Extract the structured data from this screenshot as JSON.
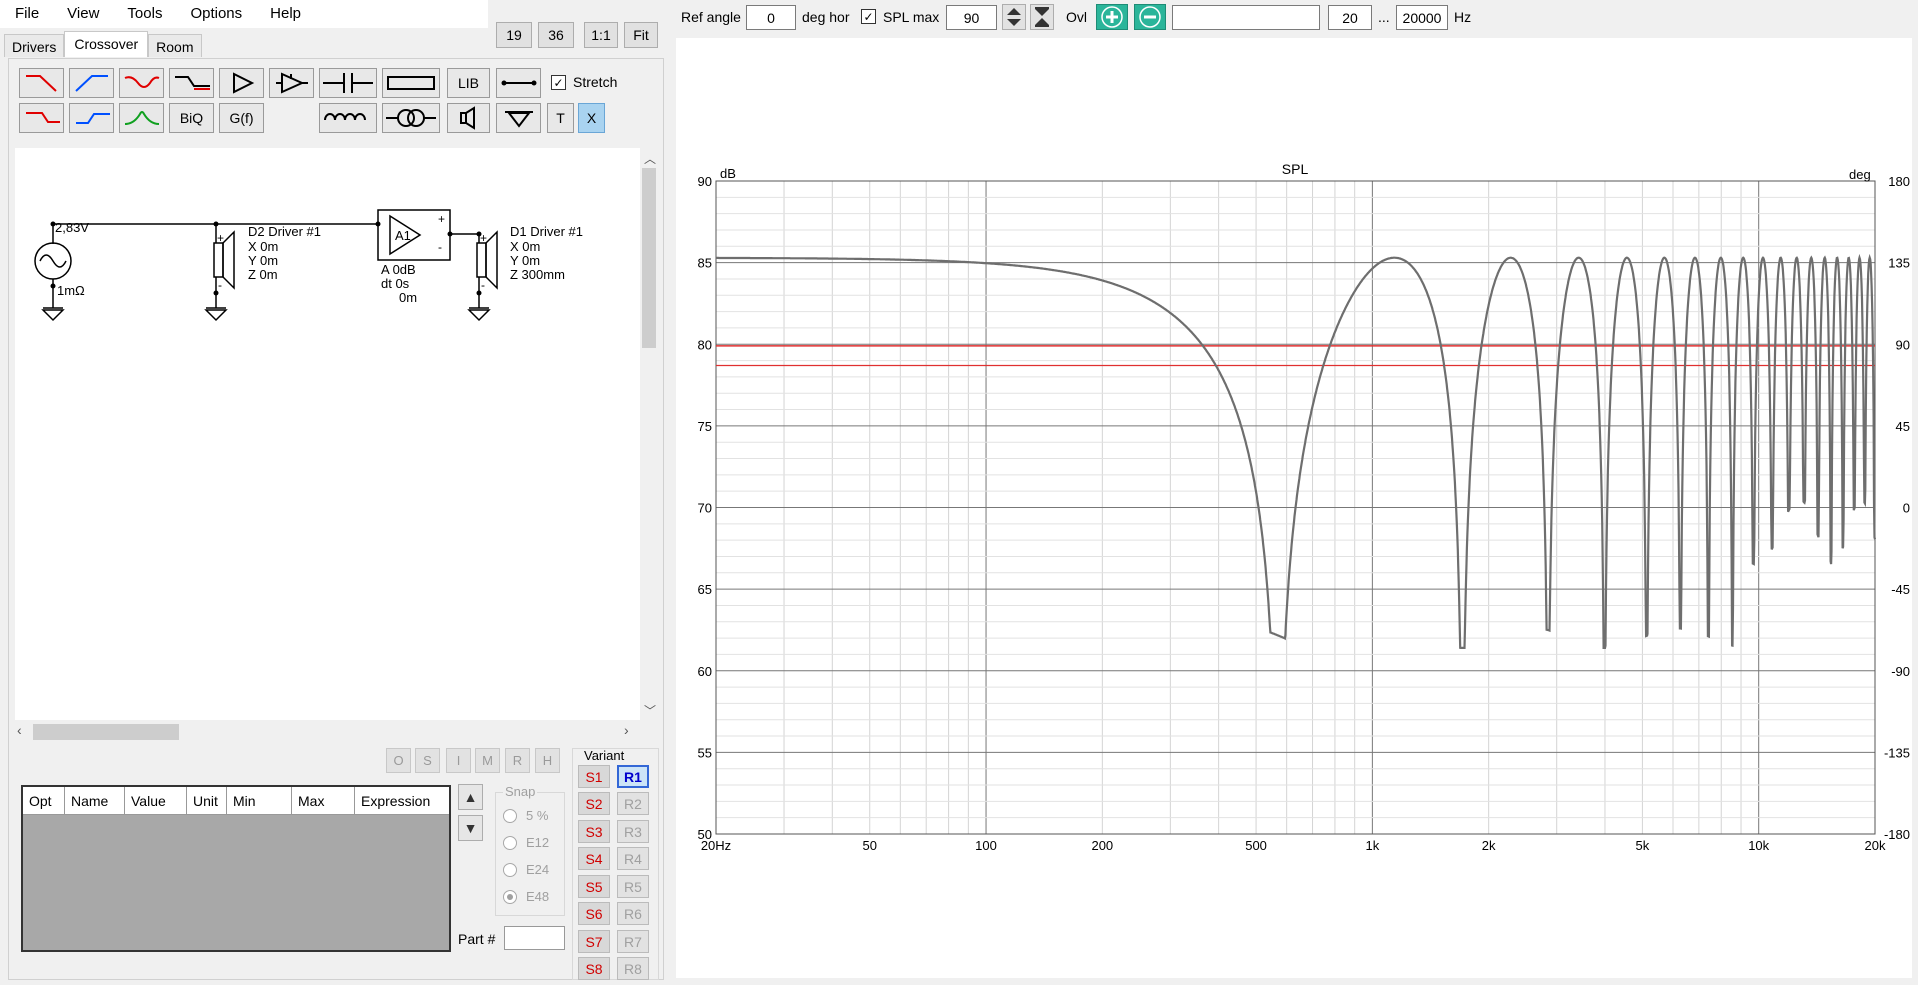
{
  "menu": [
    "File",
    "View",
    "Tools",
    "Options",
    "Help"
  ],
  "zoom_buttons": [
    "19",
    "36",
    "1:1",
    "Fit"
  ],
  "tabs": [
    "Drivers",
    "Crossover",
    "Room"
  ],
  "toolbar": {
    "lib_label": "LIB",
    "biq_label": "BiQ",
    "gf_label": "G(f)",
    "t_label": "T",
    "x_label": "X",
    "stretch_label": "Stretch",
    "stretch_checked": true
  },
  "schematic": {
    "source_voltage": "2,83V",
    "source_resistance": "1mΩ",
    "d2": {
      "name": "D2 Driver #1",
      "x": "X 0m",
      "y": "Y 0m",
      "z": "Z 0m"
    },
    "amp": {
      "label": "A1",
      "gain": "A  0dB",
      "delay": "dt 0s",
      "dist": "0m"
    },
    "d1": {
      "name": "D1 Driver #1",
      "x": "X 0m",
      "y": "Y 0m",
      "z": "Z 300mm"
    }
  },
  "opt_buttons": [
    "O",
    "S",
    "I",
    "M",
    "R",
    "H"
  ],
  "param_table": {
    "columns": [
      "Opt",
      "Name",
      "Value",
      "Unit",
      "Min",
      "Max",
      "Expression"
    ]
  },
  "snap": {
    "label": "Snap",
    "options": [
      "5 %",
      "E12",
      "E24",
      "E48"
    ],
    "selected": "E48"
  },
  "part_label": "Part #",
  "variant": {
    "label": "Variant",
    "s": [
      "S1",
      "S2",
      "S3",
      "S4",
      "S5",
      "S6",
      "S7",
      "S8"
    ],
    "r": [
      "R1",
      "R2",
      "R3",
      "R4",
      "R5",
      "R6",
      "R7",
      "R8"
    ],
    "active": "R1"
  },
  "top_controls": {
    "ref_angle_label": "Ref angle",
    "ref_angle_value": "0",
    "deg_hor_label": "deg hor",
    "spl_max_label": "SPL max",
    "spl_max_checked": true,
    "spl_max_value": "90",
    "ovl_label": "Ovl",
    "text_field": "",
    "freq_min": "20",
    "ellipsis": "...",
    "freq_max": "20000",
    "hz_label": "Hz"
  },
  "chart_data": {
    "type": "line",
    "title": "SPL",
    "ylabel": "dB",
    "y2label": "deg",
    "xscale": "log",
    "xlim": [
      20,
      20000
    ],
    "ylim": [
      50,
      90
    ],
    "y2lim": [
      -180,
      180
    ],
    "x_ticks": [
      "20Hz",
      "50",
      "100",
      "200",
      "500",
      "1k",
      "2k",
      "5k",
      "10k",
      "20k"
    ],
    "x_tick_values": [
      20,
      50,
      100,
      200,
      500,
      1000,
      2000,
      5000,
      10000,
      20000
    ],
    "y_ticks": [
      90,
      85,
      80,
      75,
      70,
      65,
      60,
      55,
      50
    ],
    "y2_ticks": [
      180,
      135,
      90,
      45,
      0,
      -45,
      -90,
      -135,
      -180
    ],
    "grid": true,
    "series": [
      {
        "values_desc": "two-source interference: flat ~85.2 dB at low freq, first null ~62.3 dB near 570 Hz, then repeating comb peaks ~85.3 dB",
        "color": "#6e6e6e",
        "x": [
          20,
          50,
          100,
          150,
          200,
          250,
          300,
          350,
          400,
          450,
          500,
          540,
          570,
          600,
          650,
          700,
          800,
          900,
          1000,
          1140,
          1300,
          1500,
          1650,
          1710,
          1800,
          2000,
          2280,
          2500,
          2700,
          2850,
          3000,
          3200,
          3420,
          3700,
          4000
        ],
        "y": [
          85.3,
          85.2,
          84.9,
          84.3,
          83.4,
          82.3,
          80.8,
          79.1,
          76.6,
          73.5,
          68.7,
          65.0,
          62.3,
          66.0,
          72.8,
          76.8,
          81.4,
          84.0,
          84.9,
          85.3,
          84.6,
          80.5,
          71.0,
          63.0,
          69.6,
          81.6,
          85.3,
          84.1,
          78.0,
          62.0,
          73.0,
          81.5,
          85.3,
          83.0,
          72.0
        ]
      },
      {
        "name": "SPL max line",
        "color": "#e03030",
        "values": [
          79.9
        ]
      },
      {
        "name": "lower red line",
        "color": "#e03030",
        "values": [
          78.7
        ]
      }
    ]
  }
}
